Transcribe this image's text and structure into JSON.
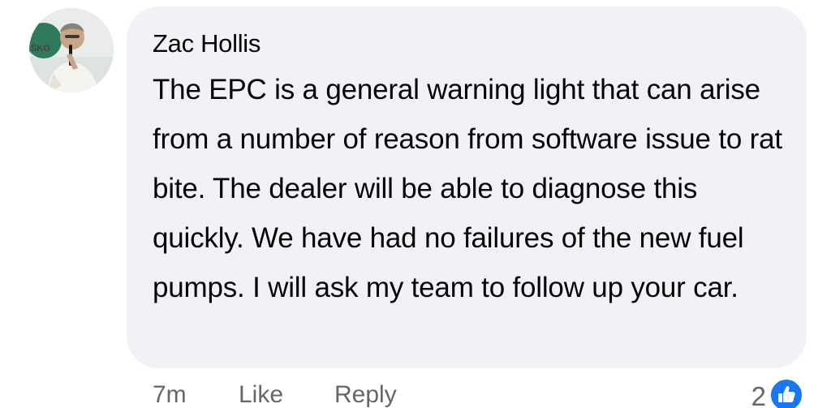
{
  "comment": {
    "author": "Zac Hollis",
    "text": "The EPC is a general warning light that can arise from a number of reason from software issue to rat bite. The dealer will be able to diagnose this quickly. We have had no failures of the new fuel pumps. I will ask my team to follow up your car.",
    "avatar_logo_text": "ŠKO"
  },
  "actions": {
    "timestamp": "7m",
    "like_label": "Like",
    "reply_label": "Reply"
  },
  "reactions": {
    "count": "2",
    "icon": "thumbs-up-icon",
    "badge_color": "#1877f2"
  },
  "colors": {
    "bubble_background": "#f0f2f5",
    "text_primary": "#050505",
    "text_secondary": "#65676b"
  }
}
